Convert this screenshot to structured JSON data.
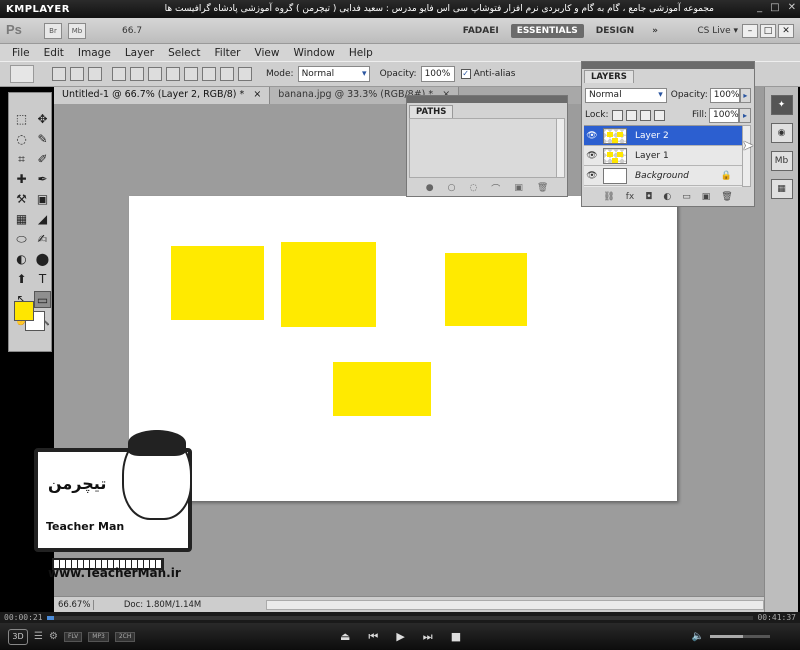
{
  "kmplayer": {
    "logo": "KMPLAYER",
    "video_title": "مجموعه آموزشی جامع ، گام به گام و کاربردی نرم افزار فتوشاپ سی اس فایو  مدرس : سعید فدایی ( تیچرمن ) گروه آموزشی پادشاه گرافیست ها",
    "win_min": "_",
    "win_max": "□",
    "win_close": "✕",
    "time_elapsed": "00:00:21",
    "time_total": "00:41:37",
    "progress_fraction": 0.01,
    "volume_fraction": 0.55,
    "btn_3d": "3D",
    "badges": [
      "FLV",
      "MP3",
      "2CH"
    ],
    "controls": [
      "⏏",
      "⏮",
      "▶",
      "⏭",
      "■"
    ],
    "volume_icon": "🔈"
  },
  "appbar": {
    "logo": "Ps",
    "br": "Br",
    "mb": "Mb",
    "zoom": "66.7",
    "workspaces": [
      "FADAEI",
      "ESSENTIALS",
      "DESIGN",
      "»"
    ],
    "active_workspace": "ESSENTIALS",
    "cs_live": "CS Live ▾",
    "win_btns": [
      "–",
      "□",
      "✕"
    ]
  },
  "menu": [
    "File",
    "Edit",
    "Image",
    "Layer",
    "Select",
    "Filter",
    "View",
    "Window",
    "Help"
  ],
  "options": {
    "mode_label": "Mode:",
    "mode_value": "Normal",
    "opacity_label": "Opacity:",
    "opacity_value": "100%",
    "antialias_label": "Anti-alias",
    "antialias_checked": "✓"
  },
  "doc_tabs": [
    {
      "label": "Untitled-1 @ 66.7% (Layer 2, RGB/8) *",
      "close": "×"
    },
    {
      "label": "banana.jpg @ 33.3% (RGB/8#) *",
      "close": "×"
    }
  ],
  "tools": [
    "⬚",
    "✥",
    "◌",
    "✎",
    "⌗",
    "✐",
    "✚",
    "✒",
    "⚒",
    "▣",
    "▦",
    "◢",
    "⬭",
    "✍",
    "◐",
    "⬤",
    "⬆",
    "T",
    "↖",
    "▭",
    "✋",
    "🔍"
  ],
  "colors": {
    "foreground": "#ffe600",
    "background": "#ffffff",
    "shape_fill": "#ffea00",
    "selection": "#2c5fd0"
  },
  "paths_panel": {
    "title": "PATHS",
    "footer_icons": [
      "●",
      "○",
      "◌",
      "⌒",
      "▣",
      "🗑"
    ]
  },
  "layers_panel": {
    "title": "LAYERS",
    "blend_mode": "Normal",
    "opacity_label": "Opacity:",
    "opacity_value": "100%",
    "lock_label": "Lock:",
    "fill_label": "Fill:",
    "fill_value": "100%",
    "arrow": "▸",
    "layers": [
      {
        "name": "Layer 2",
        "selected": true,
        "eye": "👁"
      },
      {
        "name": "Layer 1",
        "selected": false,
        "eye": "👁"
      },
      {
        "name": "Background",
        "selected": false,
        "eye": "👁",
        "lock": "🔒"
      }
    ],
    "footer_icons": [
      "⛓",
      "fx",
      "◘",
      "◐",
      "▭",
      "▣",
      "🗑"
    ]
  },
  "right_dock": [
    "✦",
    "◉",
    "Mb",
    "▦"
  ],
  "status": {
    "zoom": "66.67%",
    "doc_info": "Doc: 1.80M/1.14M"
  },
  "watermark": {
    "farsi": "تیچرمن",
    "brand": "Teacher Man",
    "url": "www.TeacherMan.ir"
  }
}
